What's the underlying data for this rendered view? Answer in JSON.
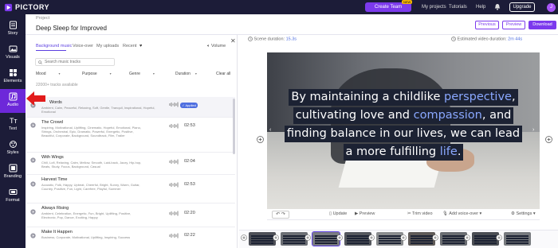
{
  "app": {
    "logo_text": "PICTORY",
    "cta_label": "Create Team",
    "cta_badge": "NEW",
    "nav_links": [
      "My projects",
      "Tutorials",
      "Help"
    ],
    "upgrade_label": "Upgrade",
    "user_initial": "J"
  },
  "left_nav": [
    {
      "label": "Story",
      "icon": "story-icon"
    },
    {
      "label": "Visuals",
      "icon": "visuals-icon"
    },
    {
      "label": "Elements",
      "icon": "elements-icon"
    },
    {
      "label": "Audio",
      "icon": "audio-icon",
      "active": true
    },
    {
      "label": "Text",
      "icon": "text-icon"
    },
    {
      "label": "Styles",
      "icon": "styles-icon"
    },
    {
      "label": "Branding",
      "icon": "branding-icon"
    },
    {
      "label": "Format",
      "icon": "format-icon"
    }
  ],
  "project": {
    "label": "Project",
    "title": "Deep Sleep for Improved",
    "previous_label": "Previous",
    "preview_label": "Preview",
    "download_label": "Download"
  },
  "audio_panel": {
    "tabs": [
      "Background music",
      "Voice-over",
      "My uploads",
      "Recent"
    ],
    "active_tab": 0,
    "volume_label": "Volume",
    "search_placeholder": "Search music tracks",
    "filters": [
      "Mood",
      "Purpose",
      "Genre",
      "Duration",
      "Clear all"
    ],
    "tracks_count": "22000+ tracks available",
    "tracks": [
      {
        "title": "Words",
        "tags": "Ambient, Calm, Peaceful, Relaxing, Soft, Gentle, Tranquil, Inspirational, Hopeful, Emotional",
        "duration": "",
        "applied": true,
        "applied_label": "Applied"
      },
      {
        "title": "The Crowd",
        "tags": "Inspiring, Motivational, Uplifting, Cinematic, Hopeful, Emotional, Piano, Strings, Orchestral, Epic, Dramatic, Powerful, Energetic, Positive, Beautiful, Corporate, Background, Soundtrack, Film, Trailer",
        "duration": "02:53",
        "applied": false
      },
      {
        "title": "With Wings",
        "tags": "Chill, Lofi, Relaxing, Calm, Mellow, Smooth, Laid-back, Jazzy, Hip-hop, Beats, Study, Focus, Background, Casual",
        "duration": "02:04",
        "applied": false
      },
      {
        "title": "Harvest Time",
        "tags": "Acoustic, Folk, Happy, Upbeat, Cheerful, Bright, Sunny, Warm, Guitar, Country, Positive, Fun, Light, Carefree, Playful, Summer",
        "duration": "02:53",
        "applied": false
      },
      {
        "title": "Always Rising",
        "tags": "Ambient, Celebration, Energetic, Fun, Bright, Uplifting, Positive, Electronic, Pop, Dance, Exciting, Happy",
        "duration": "02:20",
        "applied": false
      },
      {
        "title": "Make It Happen",
        "tags": "Business, Corporate, Motivational, Uplifting, Inspiring, Success",
        "duration": "02:22",
        "applied": false
      }
    ]
  },
  "editor": {
    "scene_duration_label": "Scene duration:",
    "scene_duration_value": "15.3s",
    "est_duration_label": "Estimated video duration:",
    "est_duration_value": "2m 44s",
    "caption_lines": [
      [
        {
          "t": "By maintaining a childlike "
        },
        {
          "t": "perspective",
          "hl": true
        },
        {
          "t": ","
        }
      ],
      [
        {
          "t": "cultivating love and "
        },
        {
          "t": "compassion",
          "hl": true
        },
        {
          "t": ", and"
        }
      ],
      [
        {
          "t": "finding balance in our lives, we can lead"
        }
      ],
      [
        {
          "t": "a more fulfilling "
        },
        {
          "t": "life",
          "hl": true
        },
        {
          "t": "."
        }
      ]
    ],
    "highlight_color": "#8aa8ff",
    "toolbar": {
      "undo": "↶",
      "redo": "↷",
      "update": "Update",
      "preview": "Preview",
      "trim": "Trim video",
      "add_voice": "Add voice-over",
      "settings": "Settings"
    }
  },
  "filmstrip": {
    "count": 10,
    "active_index": 2
  }
}
